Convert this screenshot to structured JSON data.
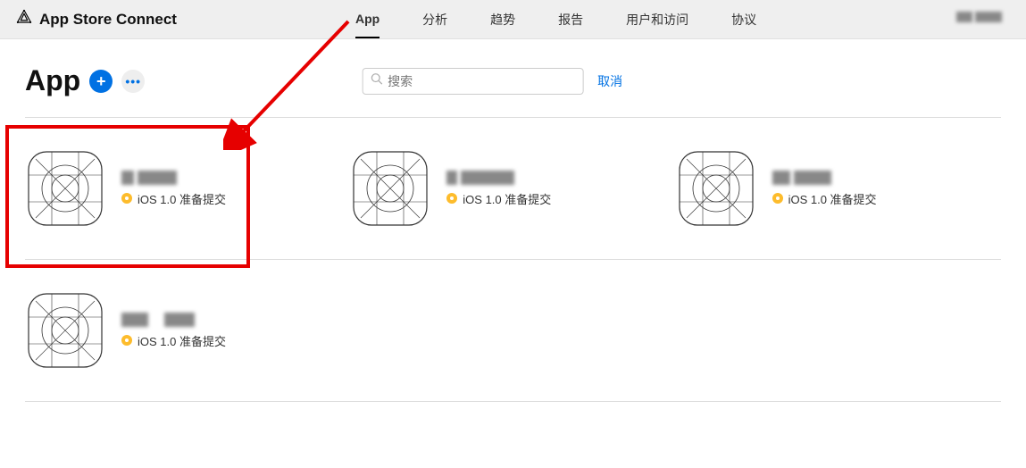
{
  "topbar": {
    "brand": "App Store Connect",
    "nav": [
      {
        "label": "App",
        "active": true
      },
      {
        "label": "分析",
        "active": false
      },
      {
        "label": "趋势",
        "active": false
      },
      {
        "label": "报告",
        "active": false
      },
      {
        "label": "用户和访问",
        "active": false
      },
      {
        "label": "协议",
        "active": false
      }
    ]
  },
  "page": {
    "title": "App",
    "search_placeholder": "搜索",
    "cancel_label": "取消"
  },
  "status_text": "iOS 1.0 准备提交",
  "apps": [
    {
      "name_redacted": true,
      "status_key": "status_text"
    },
    {
      "name_redacted": true,
      "status_key": "status_text"
    },
    {
      "name_redacted": true,
      "status_key": "status_text"
    },
    {
      "name_redacted": true,
      "status_key": "status_text"
    }
  ],
  "annotation": {
    "highlight_first_app": true,
    "arrow_from_nav_app": true
  }
}
